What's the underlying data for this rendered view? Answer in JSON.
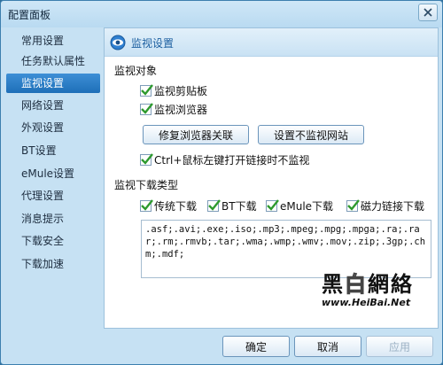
{
  "window": {
    "title": "配置面板"
  },
  "sidebar": {
    "items": [
      {
        "label": "常用设置"
      },
      {
        "label": "任务默认属性"
      },
      {
        "label": "监视设置",
        "active": true
      },
      {
        "label": "网络设置"
      },
      {
        "label": "外观设置"
      },
      {
        "label": "BT设置"
      },
      {
        "label": "eMule设置"
      },
      {
        "label": "代理设置"
      },
      {
        "label": "消息提示"
      },
      {
        "label": "下载安全"
      },
      {
        "label": "下载加速"
      }
    ]
  },
  "panel": {
    "title": "监视设置",
    "icon": "eye-icon",
    "monitor_section": {
      "label": "监视对象",
      "clipboard": {
        "label": "监视剪贴板",
        "checked": true
      },
      "browser": {
        "label": "监视浏览器",
        "checked": true
      },
      "repair_button": "修复浏览器关联",
      "exclude_sites_button": "设置不监视网站",
      "ctrl_click": {
        "label": "Ctrl+鼠标左键打开链接时不监视",
        "checked": true
      }
    },
    "download_types_section": {
      "label": "监视下载类型",
      "types": [
        {
          "label": "传统下载",
          "checked": true
        },
        {
          "label": "BT下载",
          "checked": true
        },
        {
          "label": "eMule下载",
          "checked": true
        },
        {
          "label": "磁力链接下载",
          "checked": true
        }
      ],
      "extensions": ".asf;.avi;.exe;.iso;.mp3;.mpeg;.mpg;.mpga;.ra;.rar;.rm;.rmvb;.tar;.wma;.wmp;.wmv;.mov;.zip;.3gp;.chm;.mdf;"
    }
  },
  "watermark": {
    "logo_black": "黑",
    "logo_white": "白",
    "logo_rest": "網絡",
    "url": "www.HeiBai.Net"
  },
  "footer": {
    "ok": "确定",
    "cancel": "取消",
    "apply": "应用"
  },
  "colors": {
    "accent": "#1e6fb8",
    "check": "#2e9a2e",
    "window_bg": "#c6e1f3"
  }
}
